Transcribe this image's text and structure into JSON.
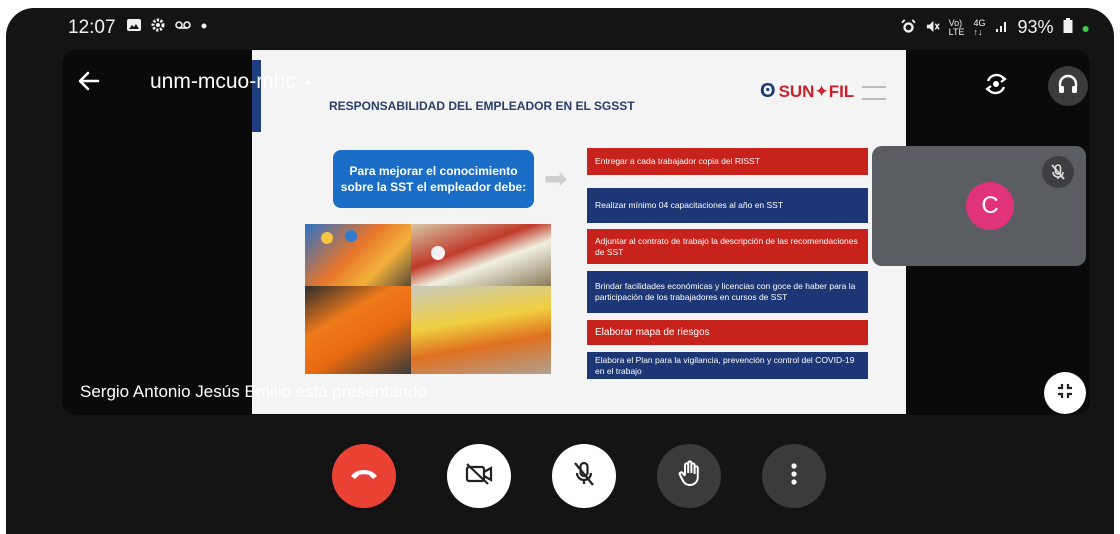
{
  "status_bar": {
    "time": "12:07",
    "left_icons": [
      "image-icon",
      "gear-icon",
      "voicemail-icon",
      "dot-icon"
    ],
    "right_icons": [
      "alarm-icon",
      "mute-icon",
      "volte-icon",
      "4g-icon",
      "signal-icon"
    ],
    "battery": "93%"
  },
  "header": {
    "meeting_code": "unm-mcuo-mhc",
    "chevron": "▸"
  },
  "slide": {
    "title": "RESPONSABILIDAD DEL EMPLEADOR EN EL SGSST",
    "logo_text": "SUN✦FIL",
    "callout": "Para mejorar el conocimiento sobre la SST el  empleador debe:",
    "items": [
      {
        "text": "Entregar a cada trabajador copia del RISST",
        "color": "red"
      },
      {
        "text": "Realizar mínimo 04 capacitaciones al año en SST",
        "color": "navy"
      },
      {
        "text": "Adjuntar al contrato de trabajo la descripción de las recomendaciones de SST",
        "color": "red"
      },
      {
        "text": "Brindar facilidades económicas y licencias con goce de haber para la participación de los trabajadores en cursos de SST",
        "color": "navy"
      },
      {
        "text": "Elaborar mapa de riesgos",
        "color": "red"
      },
      {
        "text": "Elabora el Plan para la vigilancia, prevención y control del COVID-19 en el trabajo",
        "color": "navy"
      }
    ]
  },
  "participant": {
    "initial": "C",
    "avatar_color": "#e0337a"
  },
  "presenting_text": "Sergio Antonio Jesús Emilio está presentando",
  "colors": {
    "end_call": "#e94235",
    "slide_red": "#c8221d",
    "slide_navy": "#1d3675",
    "callout_blue": "#1a6ec7"
  }
}
